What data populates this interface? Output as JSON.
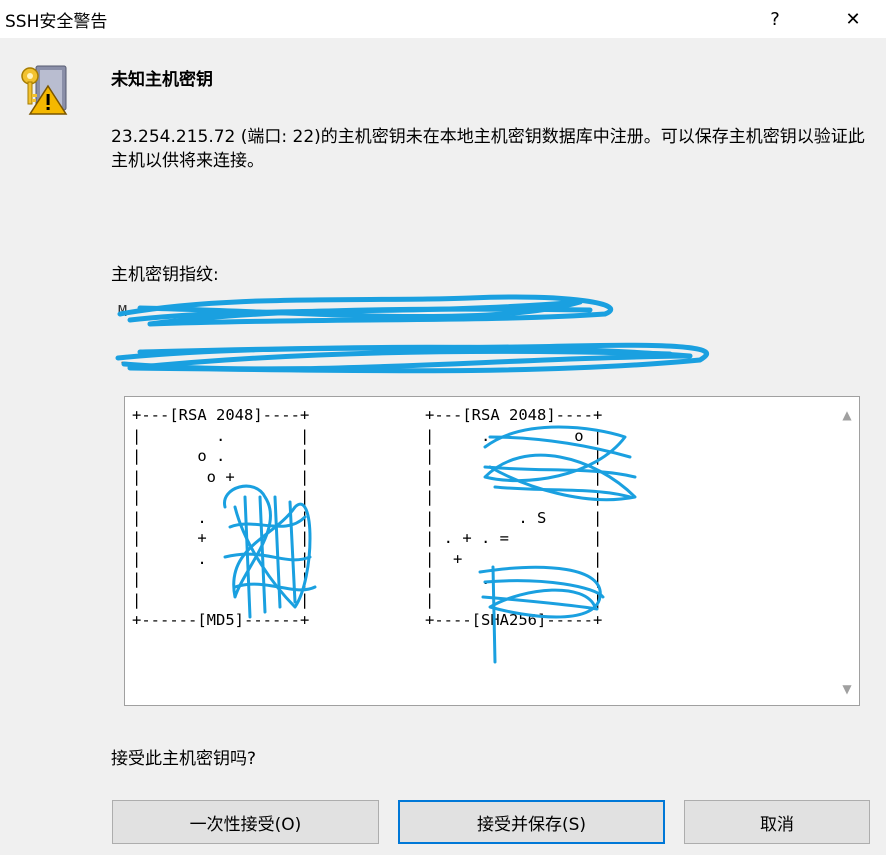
{
  "window": {
    "title": "SSH安全警告",
    "help_label": "?",
    "close_label": "✕"
  },
  "content": {
    "heading": "未知主机密钥",
    "message": "23.254.215.72 (端口: 22)的主机密钥未在本地主机密钥数据库中注册。可以保存主机密钥以验证此主机以供将来连接。",
    "fingerprint_label": "主机密钥指纹:",
    "fingerprint_lines": [
      "M",
      "."
    ],
    "randomart_left": "+---[RSA 2048]----+\n|        .        |\n|      o .        |\n|       o +       |\n|                 |\n|      .          |\n|      +          |\n|      .          |\n|                 |\n|                 |\n+------[MD5]------+",
    "randomart_right": "+---[RSA 2048]----+\n|     .         o |\n|                 |\n|                 |\n|                 |\n|         . S     |\n| . + . =         |\n|  +              |\n|     .           |\n|                 |\n+----[SHA256]-----+",
    "question": "接受此主机密钥吗?"
  },
  "buttons": {
    "accept_once": "一次性接受(O)",
    "accept_save": "接受并保存(S)",
    "cancel": "取消"
  },
  "colors": {
    "accent": "#0078d7",
    "scribble": "#1aa0e0"
  }
}
